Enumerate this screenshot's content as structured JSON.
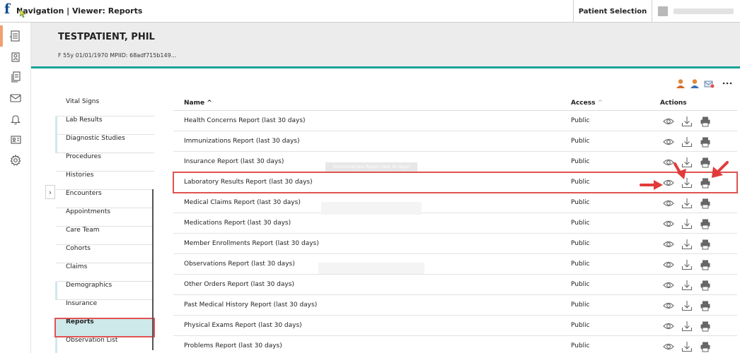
{
  "topbar": {
    "breadcrumb": "Navigation | Viewer: Reports",
    "patient_selection": "Patient Selection"
  },
  "patient": {
    "name": "TESTPATIENT, PHIL",
    "info": "F   55y   01/01/1970   MPIID: 68adf715b149..."
  },
  "nav": {
    "items": [
      {
        "label": "Vital Signs"
      },
      {
        "label": "Lab Results"
      },
      {
        "label": "Diagnostic Studies"
      },
      {
        "label": "Procedures"
      },
      {
        "label": "Histories"
      },
      {
        "label": "Encounters"
      },
      {
        "label": "Appointments"
      },
      {
        "label": "Care Team"
      },
      {
        "label": "Cohorts"
      },
      {
        "label": "Claims"
      },
      {
        "label": "Demographics"
      },
      {
        "label": "Insurance"
      },
      {
        "label": "Reports"
      },
      {
        "label": "Observation List"
      }
    ]
  },
  "table": {
    "headers": {
      "name": "Name",
      "access": "Access",
      "actions": "Actions"
    },
    "rows": [
      {
        "name": "Health Concerns Report (last 30 days)",
        "access": "Public"
      },
      {
        "name": "Immunizations Report (last 30 days)",
        "access": "Public"
      },
      {
        "name": "Insurance Report (last 30 days)",
        "access": "Public"
      },
      {
        "name": "Laboratory Results Report (last 30 days)",
        "access": "Public"
      },
      {
        "name": "Medical Claims Report (last 30 days)",
        "access": "Public"
      },
      {
        "name": "Medications Report (last 30 days)",
        "access": "Public"
      },
      {
        "name": "Member Enrollments Report (last 30 days)",
        "access": "Public"
      },
      {
        "name": "Observations Report (last 30 days)",
        "access": "Public"
      },
      {
        "name": "Other Orders Report (last 30 days)",
        "access": "Public"
      },
      {
        "name": "Past Medical History Report (last 30 days)",
        "access": "Public"
      },
      {
        "name": "Physical Exams Report (last 30 days)",
        "access": "Public"
      },
      {
        "name": "Problems Report (last 30 days)",
        "access": "Public"
      }
    ]
  },
  "tooltip": "Immunizations Report (last 30 days)",
  "icons": {
    "rail": [
      "dashboard-icon",
      "patient-record-icon",
      "documents-icon",
      "mail-icon",
      "bell-icon",
      "id-card-icon",
      "gear-icon"
    ],
    "row_actions": [
      "eye-icon",
      "download-icon",
      "print-icon"
    ],
    "toolbar": [
      "user-orange-icon",
      "user-blue-icon",
      "inbox-icon",
      "more-icon"
    ]
  },
  "colors": {
    "accent_teal": "#1aa39a",
    "highlight_red": "#e15252",
    "selected_bg": "#cde9ea",
    "brand_blue": "#0d4b8a"
  }
}
